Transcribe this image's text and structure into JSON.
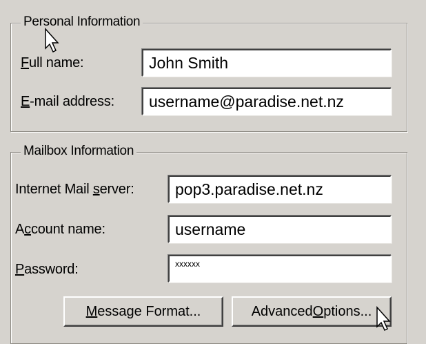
{
  "personal": {
    "legend": "Personal Information",
    "full_name": {
      "label_prefix": "",
      "label_underline": "F",
      "label_suffix": "ull name:",
      "value": "John Smith"
    },
    "email": {
      "label_prefix": "",
      "label_underline": "E",
      "label_suffix": "-mail address:",
      "value": "username@paradise.net.nz"
    }
  },
  "mailbox": {
    "legend": "Mailbox Information",
    "server": {
      "label_prefix": "Internet Mail ",
      "label_underline": "s",
      "label_suffix": "erver:",
      "value": "pop3.paradise.net.nz"
    },
    "account": {
      "label_prefix": "A",
      "label_underline": "c",
      "label_suffix": "count name:",
      "value": "username"
    },
    "password": {
      "label_prefix": "",
      "label_underline": "P",
      "label_suffix": "assword:",
      "value": "xxxxxx"
    }
  },
  "buttons": {
    "message_format": {
      "prefix": "",
      "underline": "M",
      "suffix": "essage Format..."
    },
    "advanced_options": {
      "prefix": "Advanced ",
      "underline": "O",
      "suffix": "ptions..."
    }
  },
  "icons": {
    "cursor_1": "arrow-pointer-icon",
    "cursor_2": "arrow-pointer-icon"
  }
}
